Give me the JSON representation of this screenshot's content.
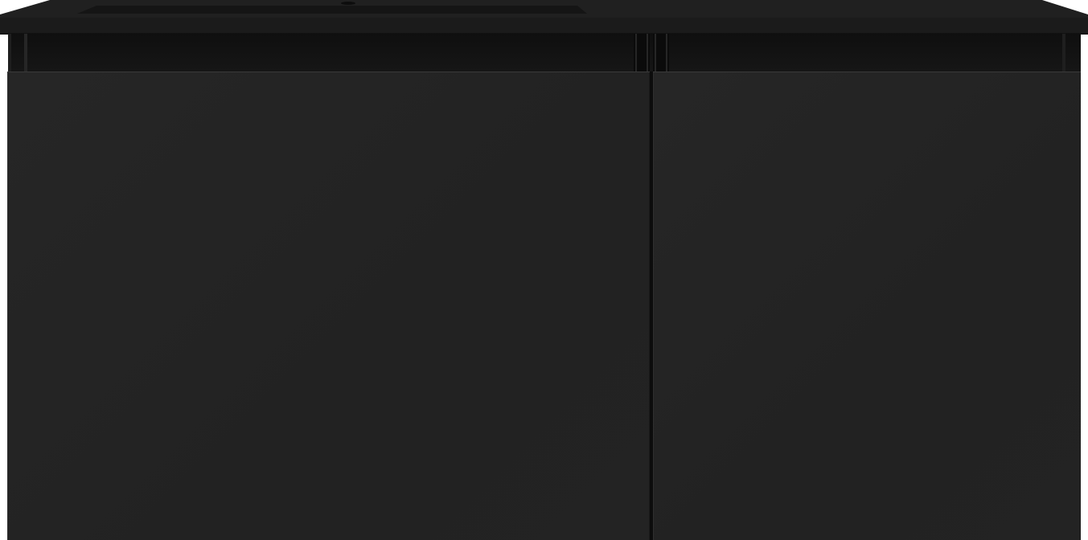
{
  "product": {
    "colors": {
      "countertop": "#1e1e1e",
      "basin": "#151515",
      "drawer_front": "#242424",
      "rail": "#121212",
      "background": "#ffffff"
    },
    "drawers": [
      {
        "position": "left"
      },
      {
        "position": "right"
      }
    ]
  }
}
